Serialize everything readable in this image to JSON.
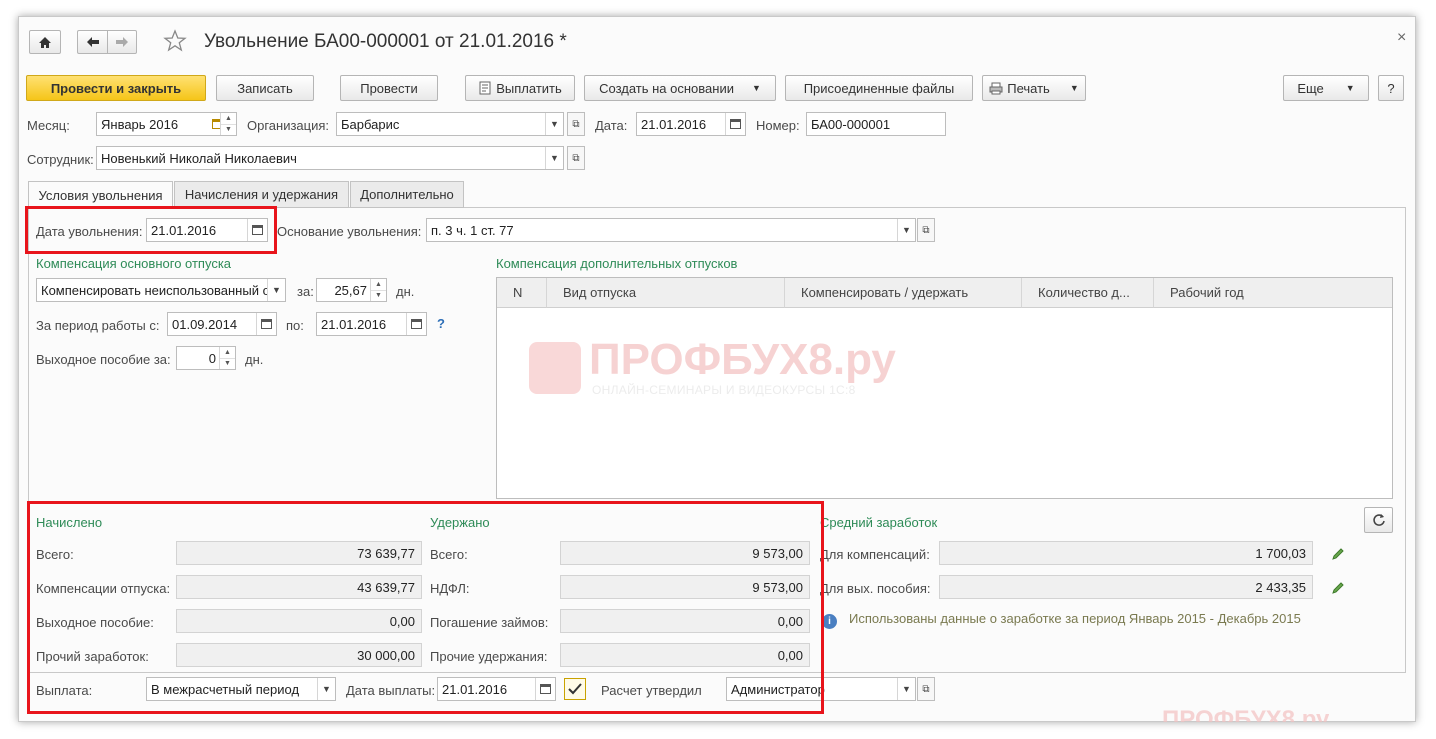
{
  "window": {
    "title": "Увольнение БА00-000001 от 21.01.2016 *",
    "close": "×"
  },
  "toolbar": {
    "post_close": "Провести и закрыть",
    "write": "Записать",
    "post": "Провести",
    "pay": "Выплатить",
    "create_based": "Создать на основании",
    "attached_files": "Присоединенные файлы",
    "print": "Печать",
    "more": "Еще",
    "help": "?"
  },
  "header": {
    "month_label": "Месяц:",
    "month_value": "Январь 2016",
    "org_label": "Организация:",
    "org_value": "Барбарис",
    "date_label": "Дата:",
    "date_value": "21.01.2016",
    "number_label": "Номер:",
    "number_value": "БА00-000001",
    "employee_label": "Сотрудник:",
    "employee_value": "Новенький Николай Николаевич"
  },
  "tabs": [
    "Условия увольнения",
    "Начисления и удержания",
    "Дополнительно"
  ],
  "conditions": {
    "dismissal_date_label": "Дата увольнения:",
    "dismissal_date": "21.01.2016",
    "basis_label": "Основание увольнения:",
    "basis_value": "п. 3 ч. 1 ст. 77",
    "main_comp_title": "Компенсация основного отпуска",
    "comp_mode": "Компенсировать неиспользованный о",
    "za": "за:",
    "days_value": "25,67",
    "days_unit": "дн.",
    "period_label": "За период работы с:",
    "period_from": "01.09.2014",
    "po": "по:",
    "period_to": "21.01.2016",
    "help_q": "?",
    "severance_label": "Выходное пособие за:",
    "severance_days": "0",
    "severance_unit": "дн.",
    "extra_comp_title": "Компенсация дополнительных отпусков",
    "grid_columns": [
      "N",
      "Вид отпуска",
      "Компенсировать / удержать",
      "Количество д...",
      "Рабочий год"
    ]
  },
  "watermark": {
    "brand": "ПРОФБУХ8.ру",
    "tagline": "ОНЛАЙН-СЕМИНАРЫ И ВИДЕОКУРСЫ 1С:8",
    "bottom_brand": "ПРОФБУХ8.ру"
  },
  "accrued": {
    "title": "Начислено",
    "rows": [
      {
        "label": "Всего:",
        "value": "73 639,77"
      },
      {
        "label": "Компенсации отпуска:",
        "value": "43 639,77"
      },
      {
        "label": "Выходное пособие:",
        "value": "0,00"
      },
      {
        "label": "Прочий заработок:",
        "value": "30 000,00"
      }
    ]
  },
  "withheld": {
    "title": "Удержано",
    "rows": [
      {
        "label": "Всего:",
        "value": "9 573,00"
      },
      {
        "label": "НДФЛ:",
        "value": "9 573,00"
      },
      {
        "label": "Погашение займов:",
        "value": "0,00"
      },
      {
        "label": "Прочие удержания:",
        "value": "0,00"
      }
    ]
  },
  "avg": {
    "title": "Средний заработок",
    "comp_label": "Для компенсаций:",
    "comp_value": "1 700,03",
    "sev_label": "Для вых. пособия:",
    "sev_value": "2 433,35",
    "info": "Использованы данные о заработке за период Январь 2015 - Декабрь 2015"
  },
  "payment": {
    "label": "Выплата:",
    "value": "В межрасчетный период",
    "date_label": "Дата выплаты:",
    "date_value": "21.01.2016",
    "approved_label": "Расчет утвердил",
    "approved_value": "Администратор"
  }
}
